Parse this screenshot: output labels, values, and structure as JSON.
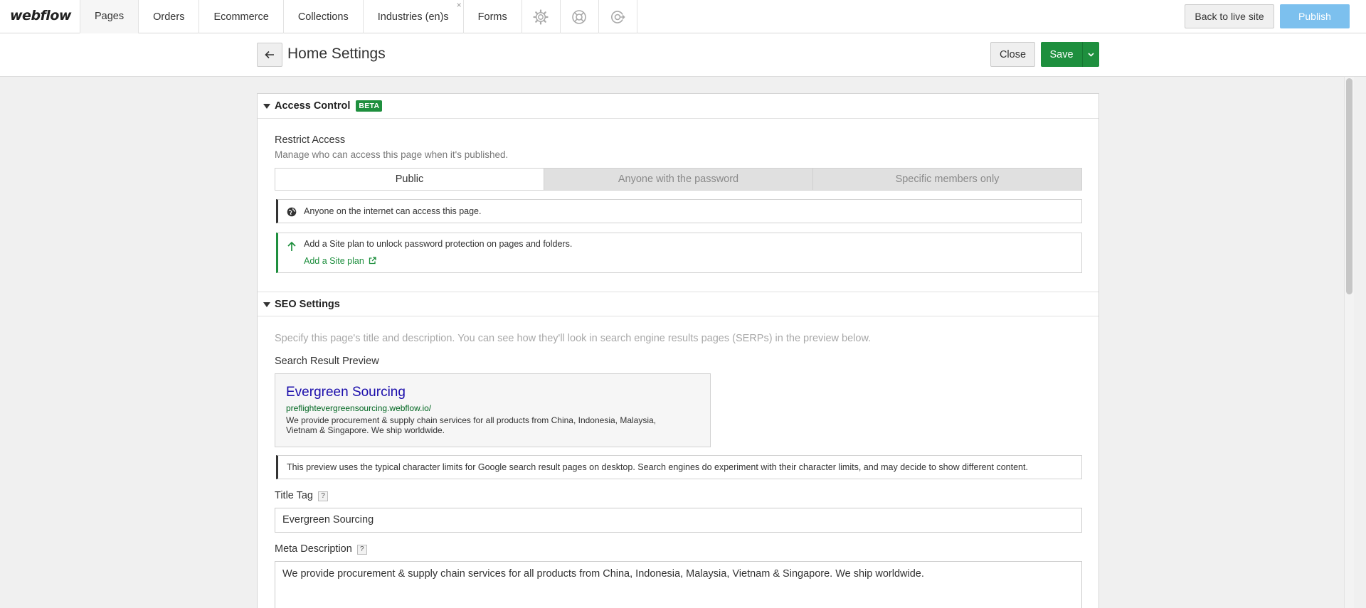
{
  "topbar": {
    "logo": "webflow",
    "tabs": [
      {
        "label": "Pages",
        "active": true
      },
      {
        "label": "Orders"
      },
      {
        "label": "Ecommerce"
      },
      {
        "label": "Collections"
      },
      {
        "label": "Industries (en)s",
        "closable": true
      },
      {
        "label": "Forms"
      }
    ],
    "icon_tabs": [
      "gear-icon",
      "help-lifebuoy-icon",
      "audit-icon"
    ],
    "close_glyph": "×",
    "back_to_live_label": "Back to live site",
    "publish_label": "Publish"
  },
  "header": {
    "title": "Home Settings",
    "close_label": "Close",
    "save_label": "Save"
  },
  "access_control": {
    "heading": "Access Control",
    "badge": "BETA",
    "restrict_label": "Restrict Access",
    "restrict_help": "Manage who can access this page when it's published.",
    "options": [
      {
        "label": "Public",
        "selected": true
      },
      {
        "label": "Anyone with the password",
        "selected": false
      },
      {
        "label": "Specific members only",
        "selected": false
      }
    ],
    "public_note": "Anyone on the internet can access this page.",
    "upgrade_note": "Add a Site plan to unlock password protection on pages and folders.",
    "upgrade_link": "Add a Site plan"
  },
  "seo": {
    "heading": "SEO Settings",
    "intro": "Specify this page's title and description. You can see how they'll look in search engine results pages (SERPs) in the preview below.",
    "preview_label": "Search Result Preview",
    "preview": {
      "title": "Evergreen Sourcing",
      "url": "preflightevergreensourcing.webflow.io/",
      "description": "We provide procurement & supply chain services for all products from China, Indonesia, Malaysia, Vietnam & Singapore. We ship worldwide."
    },
    "preview_note": "This preview uses the typical character limits for Google search result pages on desktop. Search engines do experiment with their character limits, and may decide to show different content.",
    "help_glyph": "?",
    "title_tag_label": "Title Tag",
    "title_tag_value": "Evergreen Sourcing",
    "meta_description_label": "Meta Description",
    "meta_description_value": "We provide procurement & supply chain services for all products from China, Indonesia, Malaysia, Vietnam & Singapore. We ship worldwide."
  },
  "colors": {
    "brand_green": "#1e8f3e",
    "publish_blue": "#7cc0ee",
    "serp_title": "#1a0dab",
    "serp_url": "#006621"
  }
}
